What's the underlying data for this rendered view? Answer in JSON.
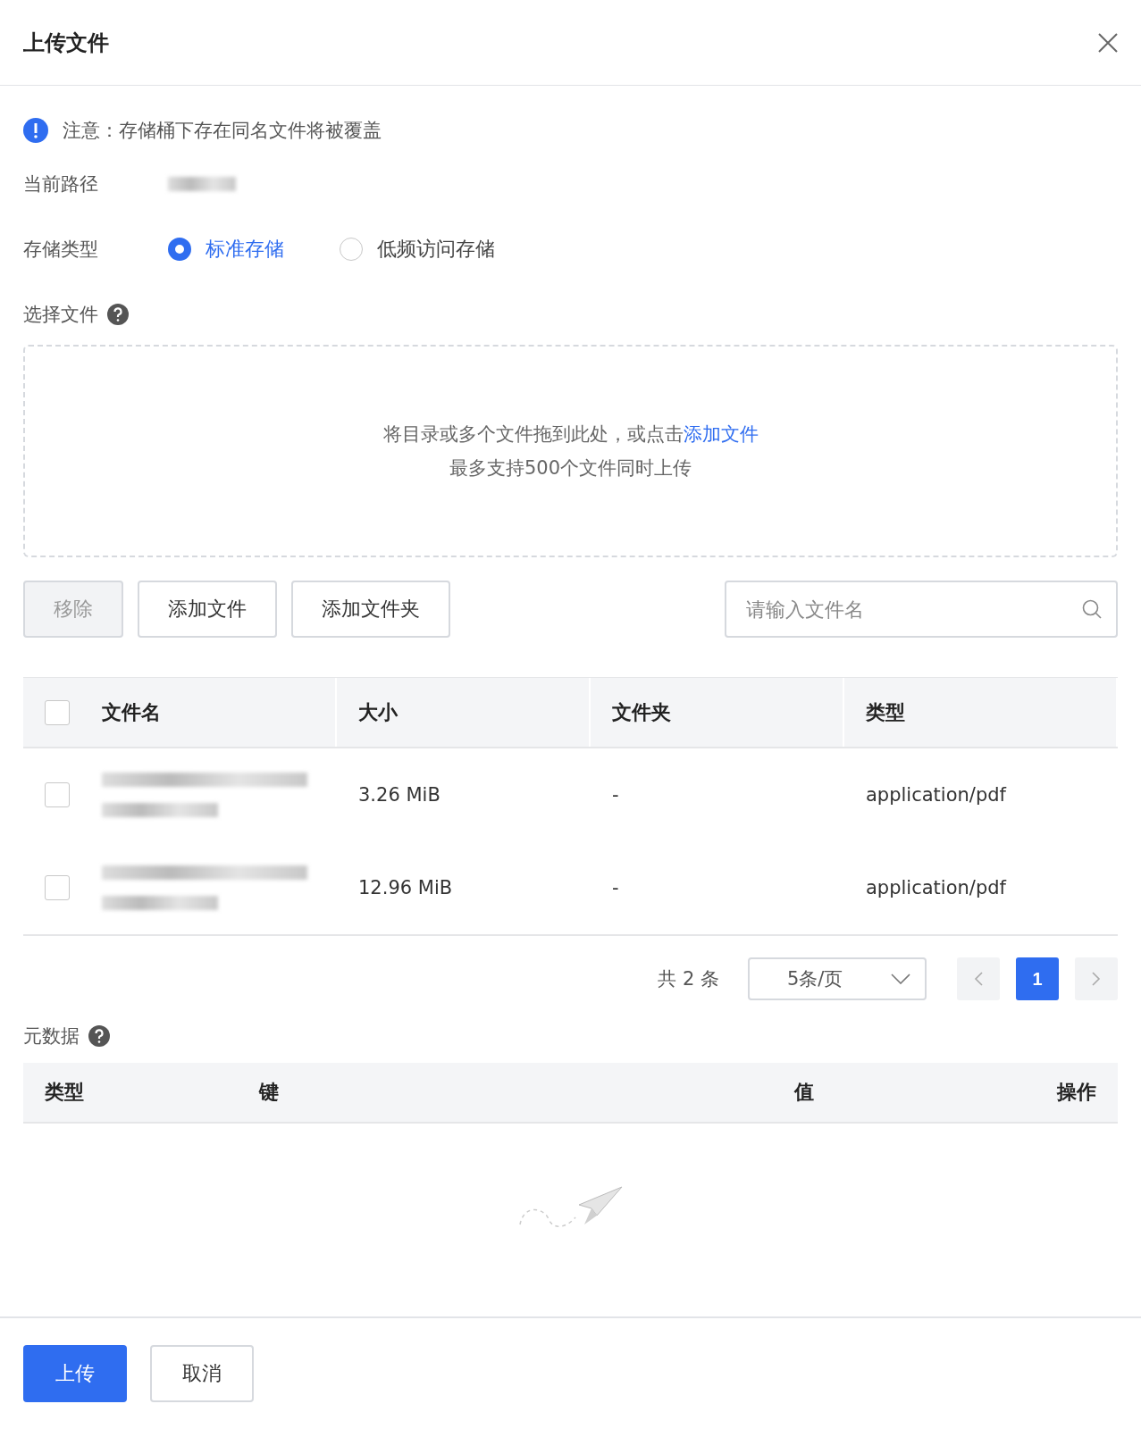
{
  "dialog": {
    "title": "上传文件"
  },
  "notice": "注意：存储桶下存在同名文件将被覆盖",
  "path": {
    "label": "当前路径"
  },
  "storage_type": {
    "label": "存储类型",
    "options": [
      {
        "label": "标准存储",
        "selected": true
      },
      {
        "label": "低频访问存储",
        "selected": false
      }
    ]
  },
  "select_files": {
    "label": "选择文件",
    "drop_text": "将目录或多个文件拖到此处，或点击",
    "drop_link": "添加文件",
    "drop_hint": "最多支持500个文件同时上传"
  },
  "actions": [
    {
      "label": "移除",
      "disabled": true
    },
    {
      "label": "添加文件",
      "disabled": false
    },
    {
      "label": "添加文件夹",
      "disabled": false
    }
  ],
  "search": {
    "placeholder": "请输入文件名"
  },
  "table": {
    "select_all_checked": false,
    "columns": [
      "文件名",
      "大小",
      "文件夹",
      "类型"
    ],
    "rows": [
      {
        "checked": false,
        "size": "3.26 MiB",
        "folder": "-",
        "type": "application/pdf"
      },
      {
        "checked": false,
        "size": "12.96 MiB",
        "folder": "-",
        "type": "application/pdf"
      }
    ]
  },
  "pagination": {
    "total": "共 2 条",
    "page_size": "5条/页",
    "pages": [
      {
        "label": "1",
        "selected": true
      }
    ]
  },
  "metadata": {
    "label": "元数据",
    "columns": [
      "类型",
      "键",
      "值",
      "操作"
    ]
  },
  "footer": {
    "buttons": [
      {
        "label": "上传",
        "kind": "primary"
      },
      {
        "label": "取消",
        "kind": "default"
      }
    ]
  }
}
